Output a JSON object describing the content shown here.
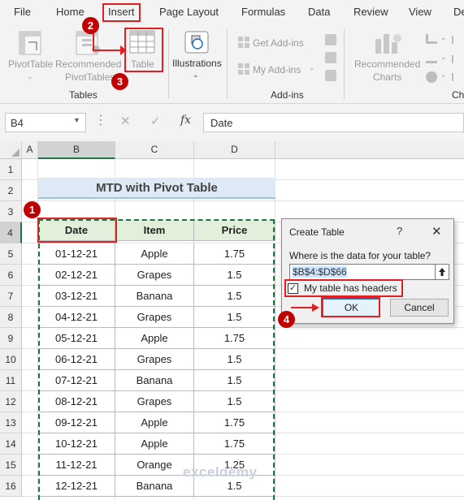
{
  "menu": [
    "File",
    "Home",
    "Insert",
    "Page Layout",
    "Formulas",
    "Data",
    "Review",
    "View",
    "De"
  ],
  "ribbon": {
    "pivot_table": "PivotTable",
    "recommended_pivot_line1": "Recommended",
    "recommended_pivot_line2": "PivotTables",
    "table": "Table",
    "illustrations": "Illustrations",
    "get_addins": "Get Add-ins",
    "my_addins": "My Add-ins",
    "recommended_charts_line1": "Recommended",
    "recommended_charts_line2": "Charts",
    "group_tables": "Tables",
    "group_addins": "Add-ins",
    "group_charts": "Ch"
  },
  "formula_bar": {
    "name_box": "B4",
    "fx": "fx",
    "content": "Date"
  },
  "sheet": {
    "columns": [
      "A",
      "B",
      "C",
      "D"
    ],
    "rows": [
      "1",
      "2",
      "3",
      "4",
      "5",
      "6",
      "7",
      "8",
      "9",
      "10",
      "11",
      "12",
      "13",
      "14",
      "15",
      "16"
    ],
    "title": "MTD with Pivot Table",
    "headers": [
      "Date",
      "Item",
      "Price"
    ],
    "data": [
      [
        "01-12-21",
        "Apple",
        "1.75"
      ],
      [
        "02-12-21",
        "Grapes",
        "1.5"
      ],
      [
        "03-12-21",
        "Banana",
        "1.5"
      ],
      [
        "04-12-21",
        "Grapes",
        "1.5"
      ],
      [
        "05-12-21",
        "Apple",
        "1.75"
      ],
      [
        "06-12-21",
        "Grapes",
        "1.5"
      ],
      [
        "07-12-21",
        "Banana",
        "1.5"
      ],
      [
        "08-12-21",
        "Grapes",
        "1.5"
      ],
      [
        "09-12-21",
        "Apple",
        "1.75"
      ],
      [
        "10-12-21",
        "Apple",
        "1.75"
      ],
      [
        "11-12-21",
        "Orange",
        "1.25"
      ],
      [
        "12-12-21",
        "Banana",
        "1.5"
      ]
    ]
  },
  "dialog": {
    "title": "Create Table",
    "help": "?",
    "close": "✕",
    "question": "Where is the data for your table?",
    "range": "$B$4:$D$66",
    "checkbox_label": "My table has headers",
    "ok": "OK",
    "cancel": "Cancel"
  },
  "badges": [
    "1",
    "2",
    "3",
    "4"
  ],
  "watermark": "exceldemy"
}
